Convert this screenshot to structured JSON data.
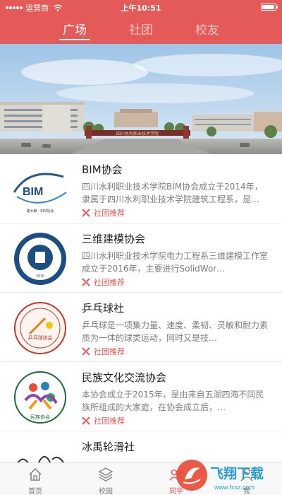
{
  "status_bar": {
    "carrier": "运营商",
    "time": "上午10:51",
    "battery_level": 0.95
  },
  "header": {
    "tabs": [
      {
        "label": "广场",
        "active": true
      },
      {
        "label": "社团",
        "active": false
      },
      {
        "label": "校友",
        "active": false
      }
    ]
  },
  "banner": {
    "gate_text": "四川水利职业技术学院"
  },
  "clubs": [
    {
      "title": "BIM协会",
      "description": "四川水利职业技术学院BIM协会成立于2014年，隶属于四川水利职业技术学院建筑工程系，是…",
      "tag": "社团推荐",
      "logo_text": "BIM",
      "logo_caption": "建木聚 · BIM协会",
      "logo_icon": "bim-logo"
    },
    {
      "title": "三维建模协会",
      "description": "四川水利职业技术学院电力工程系三维建模工作室成立于2016年，主要进行SolidWor…",
      "tag": "社团推荐",
      "logo_text": "2016",
      "logo_icon": "modeling-logo"
    },
    {
      "title": "乒乓球社",
      "description": "乒乓球是一项集力量、速度、柔韧、灵敏和耐力素质为一体的球类运动，同时又是技…",
      "tag": "社团推荐",
      "logo_text": "乒乓球协会",
      "logo_icon": "table-tennis-logo"
    },
    {
      "title": "民族文化交流协会",
      "description": "本协会成立于2015年，是由来自五湖四海不同民族所组成的大家庭，在协会成立后，…",
      "tag": "社团推荐",
      "logo_text": "民族协会",
      "logo_icon": "ethnic-culture-logo"
    },
    {
      "title": "冰禹轮滑社",
      "description": "",
      "tag": "",
      "logo_icon": "roller-skating-logo"
    }
  ],
  "bottom_nav": [
    {
      "label": "首页",
      "icon": "home-icon",
      "active": false
    },
    {
      "label": "校园",
      "icon": "campus-icon",
      "active": false
    },
    {
      "label": "同学",
      "icon": "classmates-icon",
      "active": true
    },
    {
      "label": "我",
      "icon": "profile-icon",
      "active": false
    }
  ],
  "watermark": {
    "text": "飞翔下载",
    "url": "www.fxxz.com"
  },
  "colors": {
    "brand": "#e45a58",
    "text_primary": "#222222",
    "text_secondary": "#7d7d7d"
  }
}
